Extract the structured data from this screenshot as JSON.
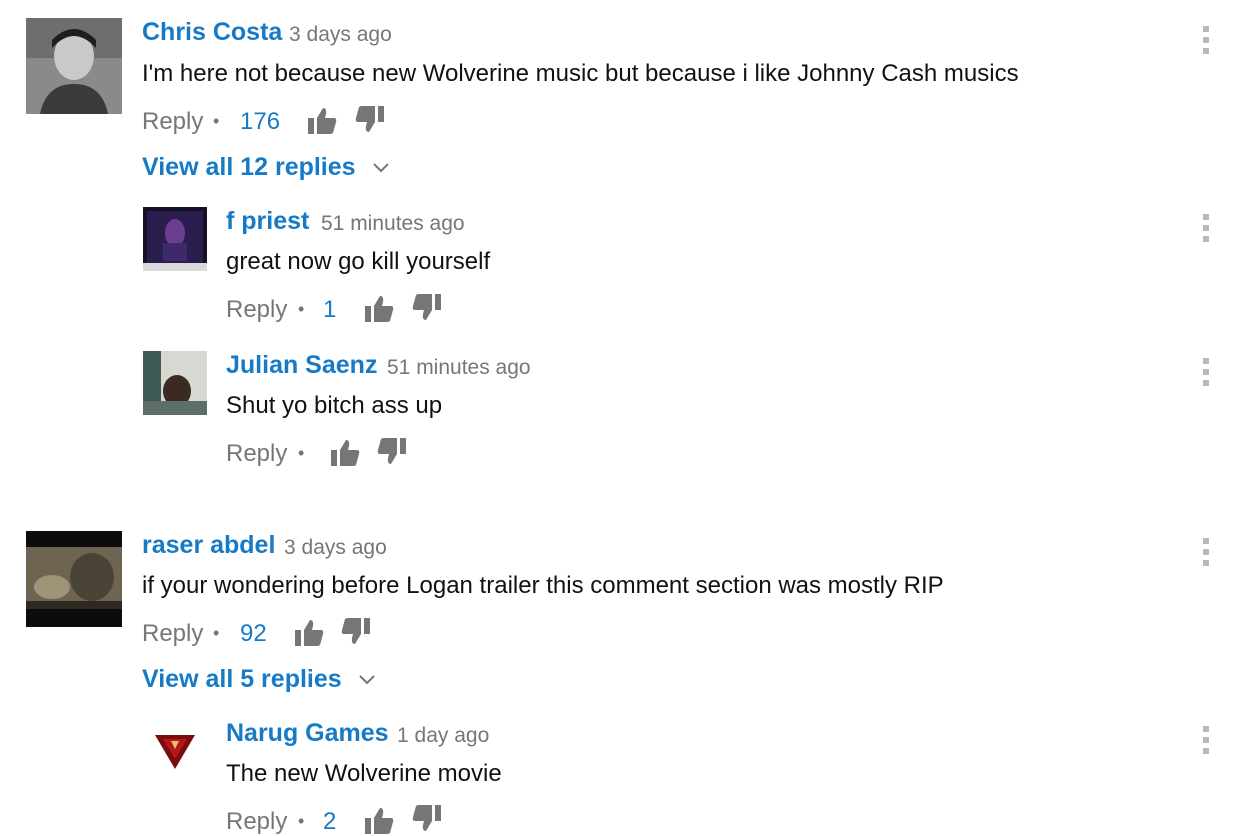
{
  "comments": [
    {
      "author": "Chris Costa",
      "time": "3 days ago",
      "text": "I'm here not because new Wolverine music but because i like Johnny Cash musics",
      "reply_label": "Reply",
      "likes": "176",
      "view_replies": "View all 12 replies",
      "replies": [
        {
          "author": "f priest",
          "time": "51 minutes ago",
          "text": "great now go kill yourself",
          "reply_label": "Reply",
          "likes": "1"
        },
        {
          "author": "Julian Saenz",
          "time": "51 minutes ago",
          "text": "Shut yo bitch ass up",
          "reply_label": "Reply",
          "likes": ""
        }
      ]
    },
    {
      "author": "raser abdel",
      "time": "3 days ago",
      "text": "if your wondering before Logan trailer this comment section was mostly RIP",
      "reply_label": "Reply",
      "likes": "92",
      "view_replies": "View all 5 replies",
      "replies": [
        {
          "author": "Narug Games",
          "time": "1 day ago",
          "text": "The new Wolverine movie",
          "reply_label": "Reply",
          "likes": "2"
        }
      ]
    }
  ],
  "icons": {
    "like": "thumbs-up-icon",
    "dislike": "thumbs-down-icon",
    "menu": "more-vertical-icon",
    "expand": "chevron-down-icon"
  },
  "colors": {
    "link": "#167ac6",
    "meta": "#767676",
    "text": "#111111",
    "icon": "#b8b8b8"
  }
}
